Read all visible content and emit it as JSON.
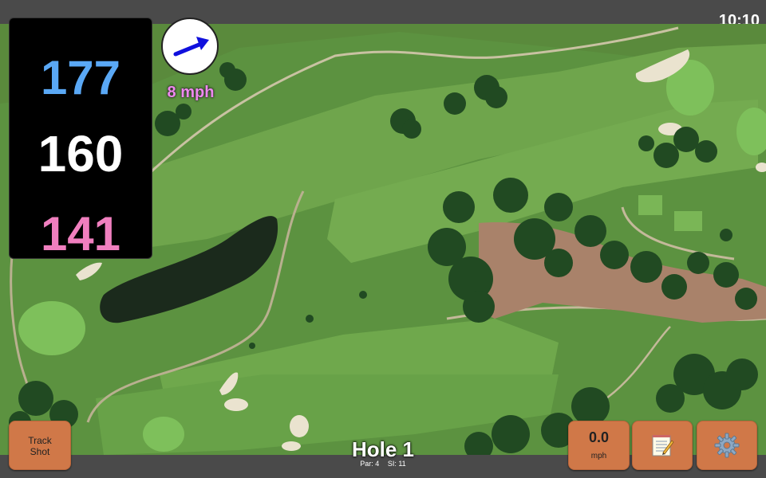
{
  "status_bar": {
    "time": "10:10"
  },
  "distances": {
    "back": "177",
    "middle": "160",
    "front": "141"
  },
  "wind": {
    "speed_label": "8 mph",
    "direction": "east-northeast"
  },
  "buttons": {
    "track_shot": {
      "line1": "Track",
      "line2": "Shot"
    },
    "wind_speed": {
      "value": "0.0",
      "unit": "mph"
    },
    "notes_icon": "notepad-icon",
    "settings_icon": "gear-icon"
  },
  "hole": {
    "title": "Hole 1",
    "par": "Par: 4",
    "stroke_index": "SI: 11"
  },
  "colors": {
    "back_distance": "#5aa8f5",
    "middle_distance": "#ffffff",
    "front_distance": "#f07fbf",
    "button_bg": "#d07848",
    "wind_label": "#ee88ee",
    "wind_arrow": "#1010dd"
  }
}
